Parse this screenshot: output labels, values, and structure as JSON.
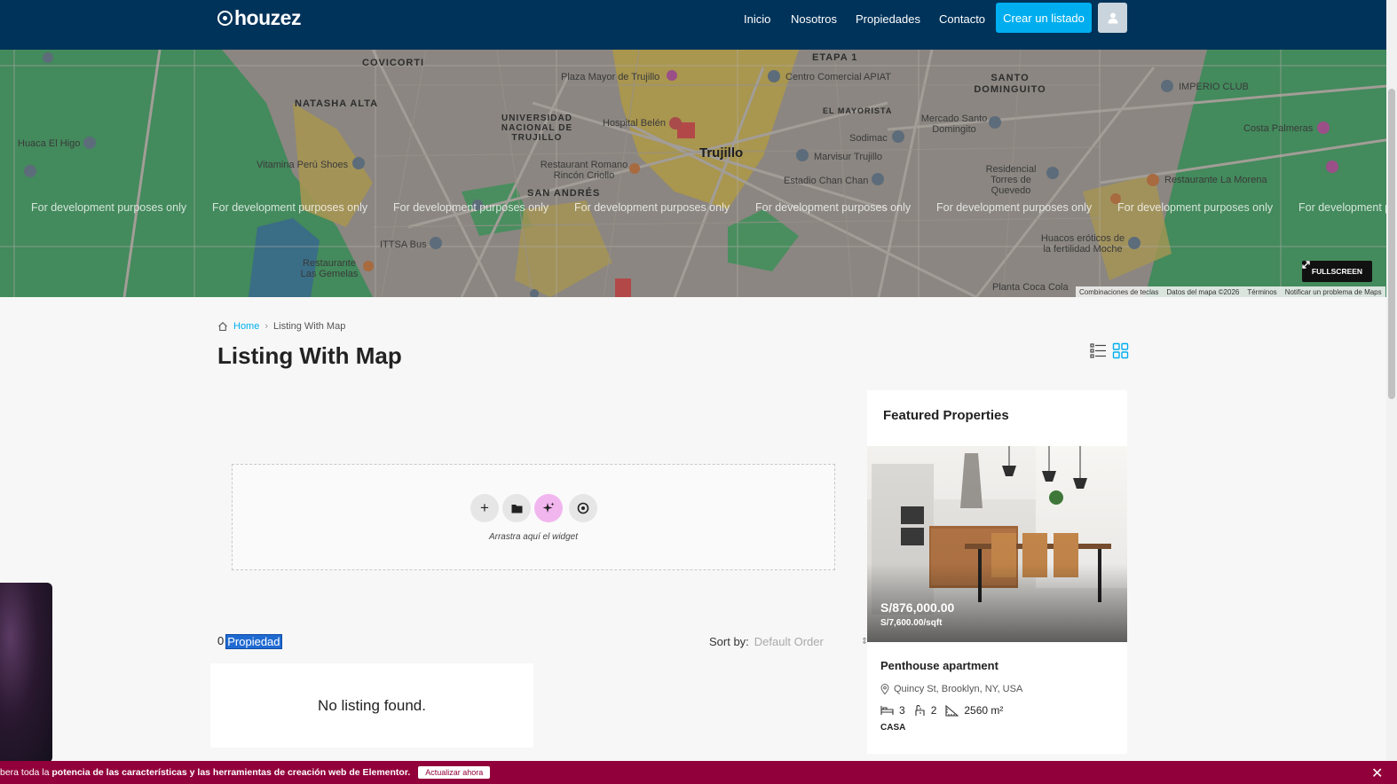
{
  "header": {
    "logo_text": "houzez",
    "nav": [
      "Inicio",
      "Nosotros",
      "Propiedades",
      "Contacto"
    ],
    "create_button": "Crear un listado",
    "brand_color": "#00335a",
    "accent_color": "#00aeef"
  },
  "map": {
    "labels": {
      "covicorti": "COVICORTI",
      "natasha": "NATASHA ALTA",
      "universidad": "UNIVERSIDAD NACIONAL DE TRUJILLO",
      "etapa": "ETAPA 1",
      "santo": "SANTO DOMINGUITO",
      "trujillo": "Trujillo",
      "mayorista": "EL MAYORISTA",
      "san_andres": "SAN ANDRÉS",
      "huaca": "Huaca El Higo",
      "vitamina": "Vitamina Perú Shoes",
      "plaza": "Plaza Mayor de Trujillo",
      "hospital": "Hospital Belén",
      "restaurant_romano": "Restaurant Romano Rincón Criollo",
      "centro": "Centro Comercial APIAT",
      "sodimac": "Sodimac",
      "marvisur": "Marvisur Trujillo",
      "estadio": "Estadio Chan Chan",
      "imperio": "IMPERIO CLUB",
      "costa": "Costa Palmeras",
      "residencial": "Residencial Torres de Quevedo",
      "restaurante_morena": "Restaurante La Morena",
      "ittsa": "ITTSA Bus",
      "gemelas": "Restaurante Las Gemelas",
      "huacos": "Huacos eróticos de la fertilidad Moche",
      "mercado": "Mercado Santo Domingito",
      "plaza_coca": "Planta Coca Cola"
    },
    "dev_text": "For development purposes only",
    "fullscreen_label": "FULLSCREEN",
    "attribution": [
      "Combinaciones de teclas",
      "Datos del mapa ©2026",
      "Términos",
      "Notificar un problema de Maps"
    ]
  },
  "breadcrumb": {
    "home": "Home",
    "current": "Listing With Map"
  },
  "page_title": "Listing With Map",
  "drop_zone": {
    "text": "Arrastra aquí el widget"
  },
  "results": {
    "count": "0",
    "unit": "Propiedad",
    "sort_label": "Sort by:",
    "sort_value": "Default Order",
    "empty_message": "No listing found."
  },
  "featured": {
    "title": "Featured Properties",
    "property": {
      "price": "S/876,000.00",
      "price_sqft": "S/7,600.00/sqft",
      "name": "Penthouse apartment",
      "address": "Quincy St, Brooklyn, NY, USA",
      "beds": "3",
      "baths": "2",
      "area": "2560 m²",
      "type": "CASA"
    }
  },
  "promo": {
    "text_prefix": "bera toda la ",
    "text_bold": "potencia de las características y las herramientas de creación web de Elementor.",
    "button": "Actualizar ahora",
    "background": "#92003b"
  }
}
